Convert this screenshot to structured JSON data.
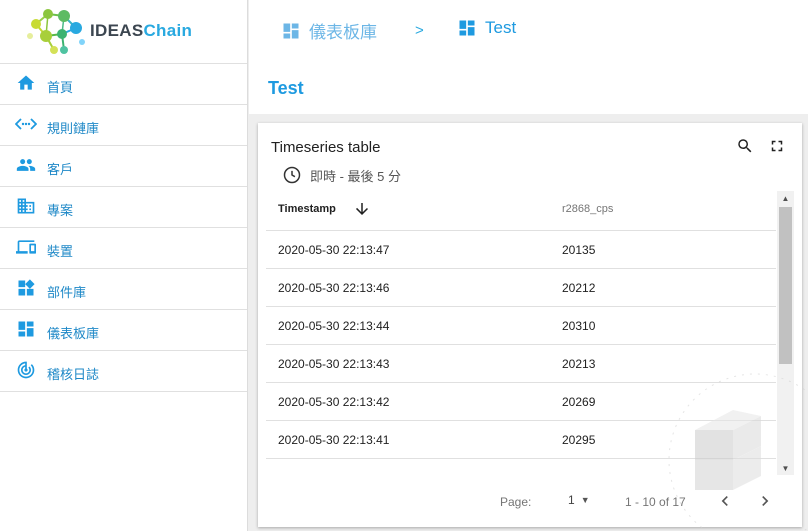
{
  "logo": {
    "part1": "IDEAS",
    "part2": "Chain"
  },
  "sidebar": {
    "items": [
      {
        "label": "首頁",
        "icon": "home-icon"
      },
      {
        "label": "規則鏈庫",
        "icon": "code-arrows-icon"
      },
      {
        "label": "客戶",
        "icon": "people-icon"
      },
      {
        "label": "專案",
        "icon": "domain-icon"
      },
      {
        "label": "裝置",
        "icon": "devices-icon"
      },
      {
        "label": "部件庫",
        "icon": "widgets-icon"
      },
      {
        "label": "儀表板庫",
        "icon": "dashboard-icon"
      },
      {
        "label": "稽核日誌",
        "icon": "track-changes-icon"
      }
    ]
  },
  "breadcrumb": {
    "first": "儀表板庫",
    "separator": ">",
    "second": "Test"
  },
  "page": {
    "title": "Test"
  },
  "widget": {
    "title": "Timeseries table",
    "timewindow": "即時 - 最後 5 分",
    "columns": {
      "timestamp": "Timestamp",
      "value": "r2868_cps"
    },
    "rows": [
      {
        "timestamp": "2020-05-30 22:13:47",
        "value": "20135"
      },
      {
        "timestamp": "2020-05-30 22:13:46",
        "value": "20212"
      },
      {
        "timestamp": "2020-05-30 22:13:44",
        "value": "20310"
      },
      {
        "timestamp": "2020-05-30 22:13:43",
        "value": "20213"
      },
      {
        "timestamp": "2020-05-30 22:13:42",
        "value": "20269"
      },
      {
        "timestamp": "2020-05-30 22:13:41",
        "value": "20295"
      },
      {
        "timestamp": "",
        "value": ""
      }
    ],
    "pagination": {
      "label": "Page:",
      "page": "1",
      "range": "1 - 10 of 17"
    }
  },
  "colors": {
    "accent": "#1e9ae0",
    "menu_text": "#1e88c7"
  }
}
